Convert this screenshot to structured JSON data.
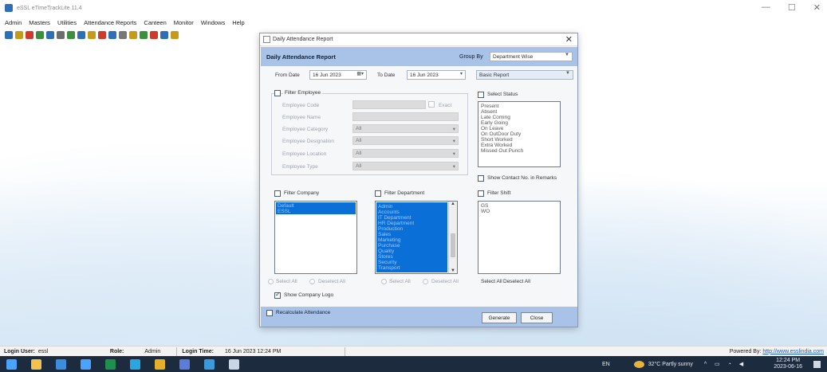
{
  "app": {
    "title": "eSSL eTimeTrackLite 11.4"
  },
  "window_controls": {
    "minimize": "—",
    "maximize": "☐",
    "close": "✕"
  },
  "menu": [
    "Admin",
    "Masters",
    "Utilities",
    "Attendance Reports",
    "Canteen",
    "Monitor",
    "Windows",
    "Help"
  ],
  "toolbar_icons": [
    "users-icon",
    "key-icon",
    "report-icon",
    "lock-icon",
    "grid-icon",
    "people-icon",
    "device-icon",
    "table-icon",
    "list-icon",
    "document-icon",
    "chart-icon",
    "print-icon",
    "settings-icon",
    "flag-icon",
    "tools-icon",
    "export-icon",
    "import-icon"
  ],
  "dialog": {
    "title": "Daily Attendance Report",
    "close": "✕",
    "header_title": "Daily Attendance Report",
    "group_by_label": "Group By",
    "group_by_value": "Department Wise",
    "from_date_label": "From Date",
    "from_date": "16 Jun 2023",
    "to_date_label": "To Date",
    "to_date": "16 Jun 2023",
    "report_type": "Basic Report",
    "filter_employee": {
      "label": "Filter Employee",
      "exact_label": "Exact",
      "fields": [
        {
          "label": "Employee Code",
          "value": ""
        },
        {
          "label": "Employee Name",
          "value": ""
        },
        {
          "label": "Employee Category",
          "value": "All"
        },
        {
          "label": "Employee Designation",
          "value": "All"
        },
        {
          "label": "Employee Location",
          "value": "All"
        },
        {
          "label": "Employee Type",
          "value": "All"
        }
      ]
    },
    "select_status": {
      "label": "Select Status",
      "items": [
        "Present",
        "Absent",
        "Late Coming",
        "Early Going",
        "On Leave",
        "On OutDoor Duty",
        "Short Worked",
        "Extra Worked",
        "Missed Out Punch"
      ]
    },
    "show_contact_label": "Show Contact No. in Remarks",
    "filter_company": {
      "label": "Filter Company",
      "items": [
        "Default",
        "ESSL"
      ]
    },
    "filter_department": {
      "label": "Filter Department",
      "items": [
        "Admin",
        "Accounts",
        "IT Department",
        "HR Department",
        "Production",
        "Sales",
        "Marketing",
        "Purchase",
        "Quality",
        "Stores",
        "Security",
        "Transport"
      ]
    },
    "filter_shift": {
      "label": "Filter Shift",
      "items": [
        "GS",
        "WO"
      ]
    },
    "select_all_label": "Select All",
    "deselect_all_label": "Deselect All",
    "show_company_logo_label": "Show Company Logo",
    "recalculate_label": "Recalculate Attendance",
    "generate_label": "Generate",
    "close_label": "Close"
  },
  "status_bar": {
    "login_user_label": "Login User:",
    "login_user": "essl",
    "role_label": "Role:",
    "role": "Admin",
    "login_time_label": "Login Time:",
    "login_time": "16 Jun 2023 12:24 PM",
    "powered_label": "Powered By:",
    "powered_link": "http://www.esslindia.com"
  },
  "taskbar": {
    "apps": [
      "windows-start-icon",
      "file-explorer-icon",
      "store-icon",
      "mail-icon",
      "excel-icon",
      "edge-icon",
      "chrome-icon",
      "app-icon",
      "terminal-icon",
      "essl-app-icon"
    ],
    "language": "EN",
    "weather": "32°C  Partly sunny",
    "time": "12:24 PM",
    "date": "2023-06-16"
  },
  "colors": {
    "accent": "#a9c3e8",
    "selection": "#0a6fd6",
    "taskbar": "#1d2b3f"
  }
}
